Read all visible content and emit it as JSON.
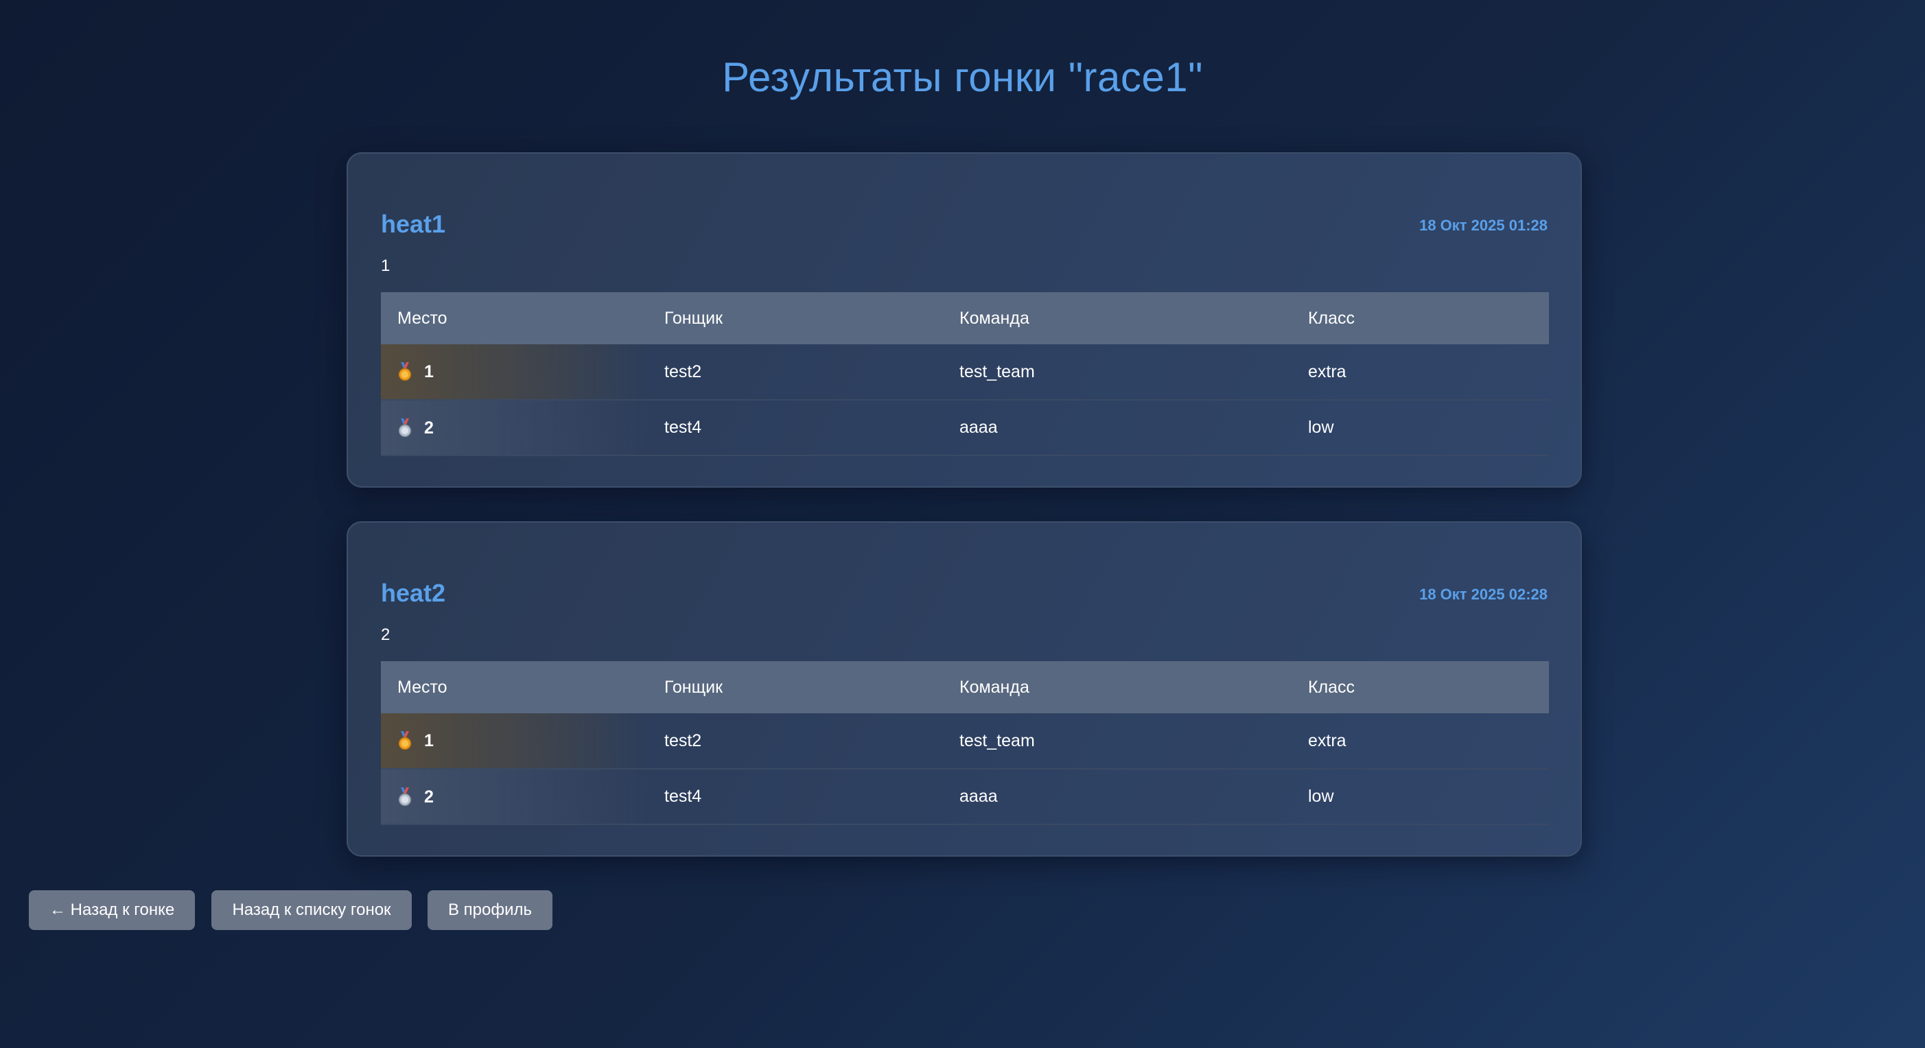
{
  "page": {
    "title": "Результаты гонки \"race1\""
  },
  "table_headers": {
    "place": "Место",
    "racer": "Гонщик",
    "team": "Команда",
    "class": "Класс"
  },
  "heats": [
    {
      "name": "heat1",
      "date": "18 Окт 2025 01:28",
      "description": "1",
      "rows": [
        {
          "medal": "gold-medal-icon",
          "place": "1",
          "racer": "test2",
          "team": "test_team",
          "class": "extra"
        },
        {
          "medal": "silver-medal-icon",
          "place": "2",
          "racer": "test4",
          "team": "aaaa",
          "class": "low"
        }
      ]
    },
    {
      "name": "heat2",
      "date": "18 Окт 2025 02:28",
      "description": "2",
      "rows": [
        {
          "medal": "gold-medal-icon",
          "place": "1",
          "racer": "test2",
          "team": "test_team",
          "class": "extra"
        },
        {
          "medal": "silver-medal-icon",
          "place": "2",
          "racer": "test4",
          "team": "aaaa",
          "class": "low"
        }
      ]
    }
  ],
  "buttons": {
    "back_to_race": "← Назад к гонке",
    "back_to_list": "Назад к списку гонок",
    "to_profile": "В профиль"
  },
  "colors": {
    "accent": "#5aa0ea",
    "gold": "#f0b429",
    "button_bg": "#6b7588",
    "table_header_bg": "#586880"
  }
}
